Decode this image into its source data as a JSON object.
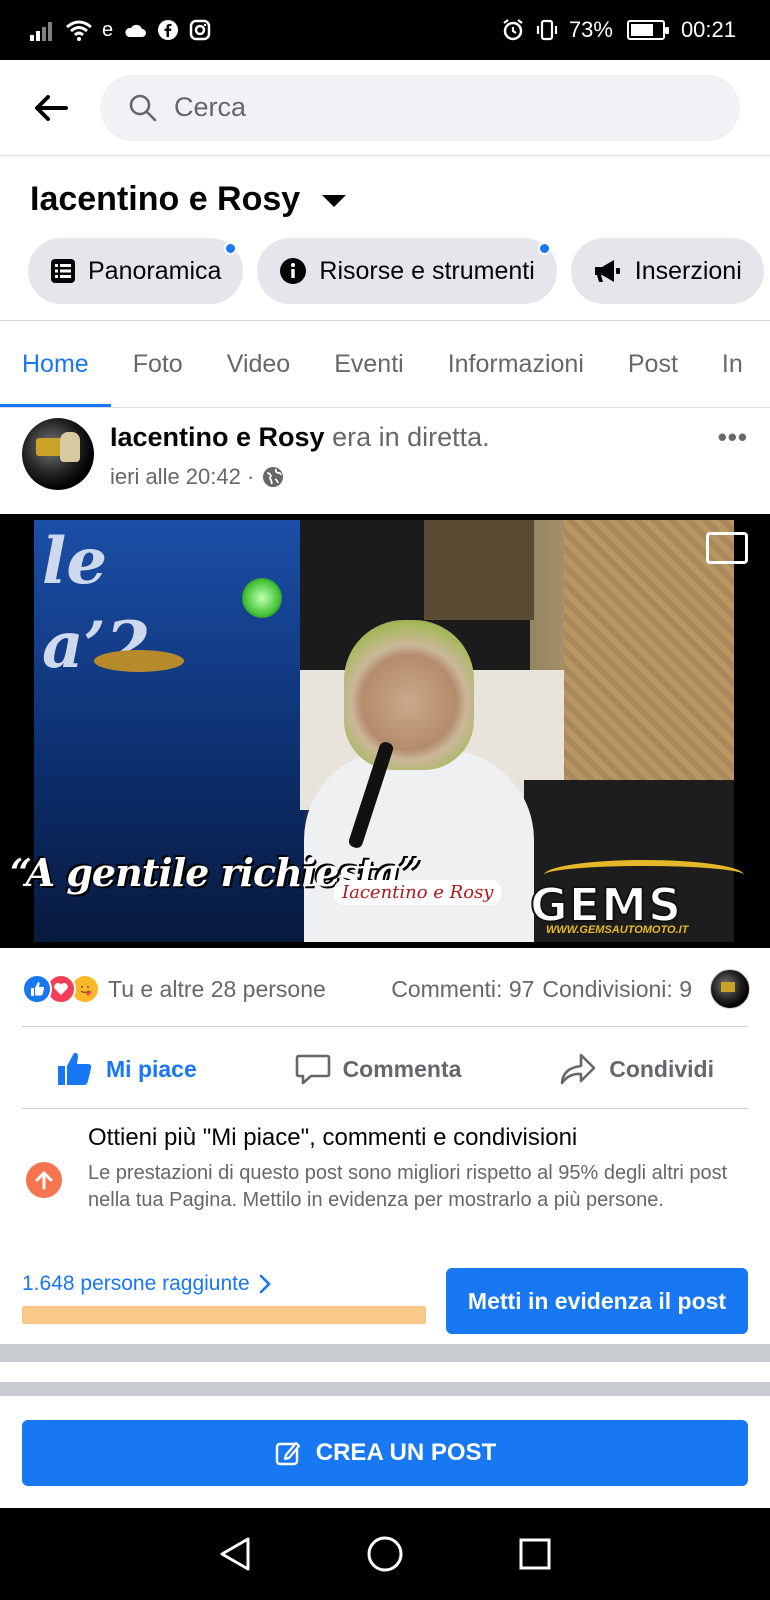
{
  "status_bar": {
    "battery_percent": "73%",
    "battery_level": 0.73,
    "time": "00:21",
    "icons": [
      "signal-icon",
      "wifi-icon",
      "data-icon",
      "cloud-icon",
      "facebook-icon",
      "instagram-icon",
      "alarm-icon",
      "vibrate-icon",
      "battery-icon"
    ]
  },
  "search": {
    "placeholder": "Cerca"
  },
  "page": {
    "title": "Iacentino e Rosy",
    "pills": [
      {
        "label": "Panoramica",
        "icon": "list-icon"
      },
      {
        "label": "Risorse e strumenti",
        "icon": "info-icon"
      },
      {
        "label": "Inserzioni",
        "icon": "megaphone-icon"
      }
    ]
  },
  "tabs": [
    "Home",
    "Foto",
    "Video",
    "Eventi",
    "Informazioni",
    "Post",
    "In"
  ],
  "post": {
    "author": "Iacentino e Rosy",
    "action": "era in diretta.",
    "time": "ieri alle 20:42 ·",
    "video": {
      "stage_text": "le\na'2",
      "caption": "“A gentile richiesta”",
      "logo_small": "Iacentino e Rosy",
      "sponsor": "GEMS",
      "sponsor_url": "WWW.GEMSAUTOMOTO.IT"
    },
    "reactions_text": "Tu e altre 28 persone",
    "comments": "Commenti: 97",
    "shares": "Condivisioni: 9",
    "actions": {
      "like": "Mi piace",
      "comment": "Commenta",
      "share": "Condividi"
    },
    "insight": {
      "title": "Ottieni più \"Mi piace\", commenti e condivisioni",
      "body": "Le prestazioni di questo post sono migliori rispetto al 95% degli altri post nella tua Pagina. Mettilo in evidenza per mostrarlo a più persone."
    },
    "reach": "1.648 persone raggiunte",
    "reach_progress": 1.0,
    "boost_label": "Metti in evidenza il post"
  },
  "create_post_label": "CREA UN POST",
  "colors": {
    "accent": "#1877f2",
    "boost_icon": "#f5754e"
  }
}
